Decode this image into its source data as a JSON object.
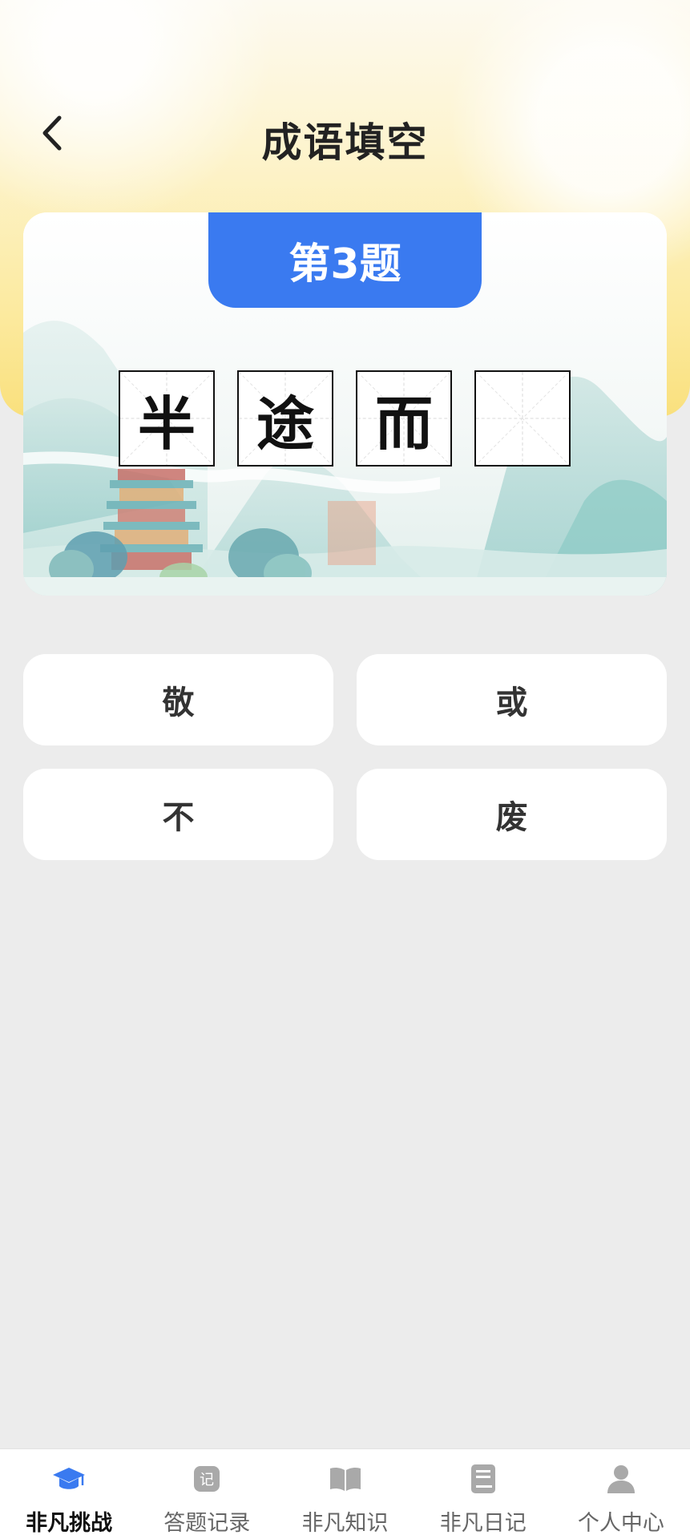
{
  "header": {
    "title": "成语填空"
  },
  "question": {
    "badge": "第3题",
    "cells": [
      "半",
      "途",
      "而",
      ""
    ]
  },
  "options": [
    "敬",
    "或",
    "不",
    "废"
  ],
  "tabbar": {
    "items": [
      {
        "label": "非凡挑战",
        "icon": "graduation-cap-icon",
        "active": true
      },
      {
        "label": "答题记录",
        "icon": "record-icon",
        "icon_text": "记",
        "active": false
      },
      {
        "label": "非凡知识",
        "icon": "book-open-icon",
        "active": false
      },
      {
        "label": "非凡日记",
        "icon": "diary-icon",
        "active": false
      },
      {
        "label": "个人中心",
        "icon": "person-icon",
        "active": false
      }
    ]
  },
  "colors": {
    "accent": "#3a7af0",
    "tab_icon_inactive": "#a9a9a9",
    "background": "#ececec"
  }
}
